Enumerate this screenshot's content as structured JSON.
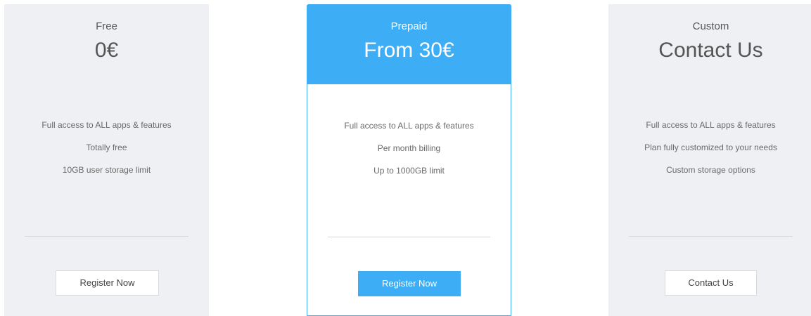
{
  "colors": {
    "accent": "#3daef6",
    "card_bg": "#eef0f3",
    "text": "#555555"
  },
  "plans": [
    {
      "name": "Free",
      "price": "0€",
      "features": [
        "Full access to ALL apps & features",
        "Totally free",
        "10GB user storage limit"
      ],
      "button_label": "Register Now"
    },
    {
      "name": "Prepaid",
      "price": "From 30€",
      "features": [
        "Full access to ALL apps & features",
        "Per month billing",
        "Up to 1000GB limit"
      ],
      "button_label": "Register Now"
    },
    {
      "name": "Custom",
      "price": "Contact Us",
      "features": [
        "Full access to ALL apps & features",
        "Plan fully customized to your needs",
        "Custom storage options"
      ],
      "button_label": "Contact Us"
    }
  ]
}
